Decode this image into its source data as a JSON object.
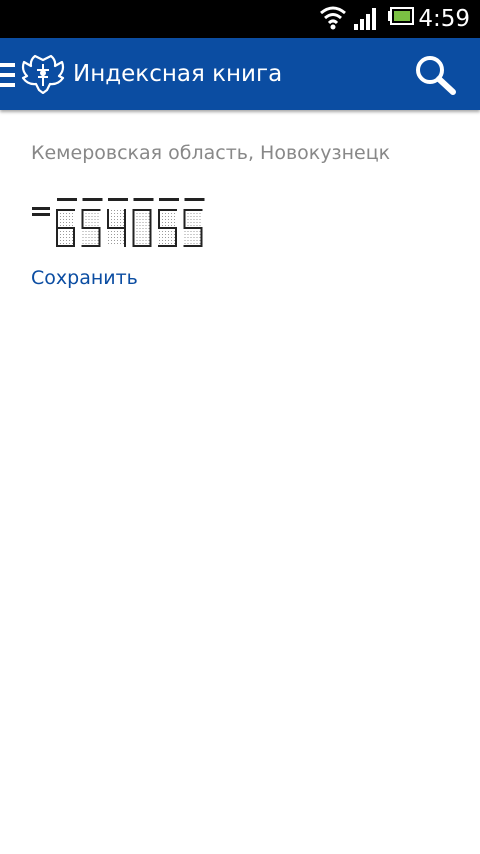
{
  "status_bar": {
    "time": "4:59",
    "icons": [
      "wifi-icon",
      "signal-icon",
      "battery-icon"
    ]
  },
  "app_bar": {
    "title": "Индексная книга",
    "icons": [
      "menu-icon",
      "russian-post-logo-icon",
      "search-icon"
    ],
    "color": "#0b4da2"
  },
  "main": {
    "region": "Кемеровская область, Новокузнецк",
    "postal_code": "654055",
    "save_label": "Сохранить"
  },
  "colors": {
    "accent": "#0b4da2",
    "secondary_text": "#888888",
    "digit": "#222222"
  }
}
